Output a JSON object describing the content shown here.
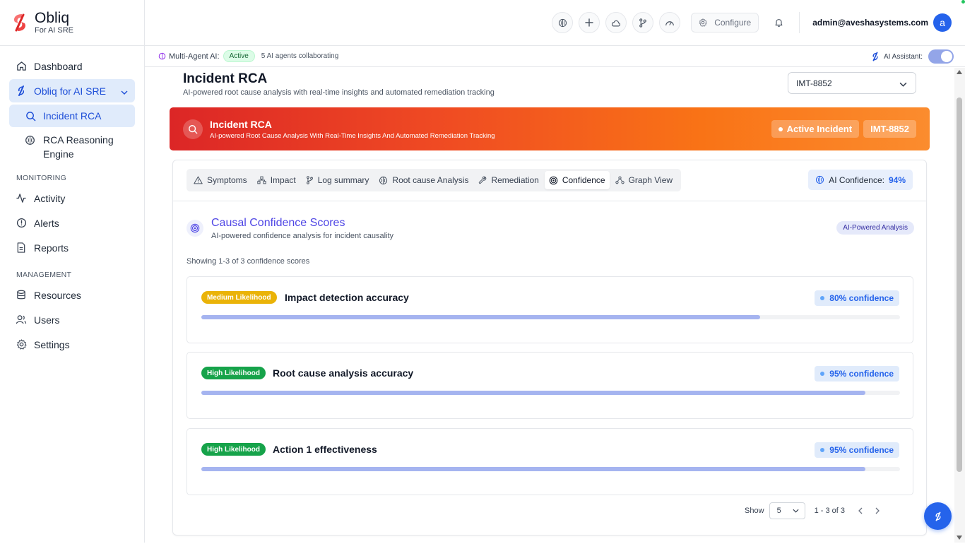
{
  "brand": {
    "name": "Obliq",
    "subtitle": "For AI SRE"
  },
  "sidebar": {
    "items": [
      {
        "label": "Dashboard",
        "icon": "home-icon"
      },
      {
        "label": "Obliq for AI SRE",
        "icon": "obliq-logo-icon"
      },
      {
        "label": "Incident RCA",
        "icon": "search-icon"
      },
      {
        "label": "RCA Reasoning Engine",
        "icon": "brain-icon"
      }
    ],
    "monitoring_title": "MONITORING",
    "monitoring": [
      {
        "label": "Activity",
        "icon": "activity-icon"
      },
      {
        "label": "Alerts",
        "icon": "alert-icon"
      },
      {
        "label": "Reports",
        "icon": "report-icon"
      }
    ],
    "management_title": "MANAGEMENT",
    "management": [
      {
        "label": "Resources",
        "icon": "database-icon"
      },
      {
        "label": "Users",
        "icon": "users-icon"
      },
      {
        "label": "Settings",
        "icon": "gear-icon"
      }
    ]
  },
  "topbar": {
    "configure_label": "Configure",
    "user_email": "admin@aveshasystems.com",
    "avatar_letter": "a"
  },
  "agentbar": {
    "label": "Multi-Agent AI:",
    "status": "Active",
    "note": "5 AI agents collaborating",
    "assistant_label": "AI Assistant:"
  },
  "page": {
    "title": "Incident RCA",
    "subtitle": "AI-powered root cause analysis with real-time insights and automated remediation tracking",
    "incident_select": "IMT-8852"
  },
  "banner": {
    "title": "Incident RCA",
    "subtitle": "AI-powered Root Cause Analysis With Real-Time Insights And Automated Remediation Tracking",
    "status_tag": "Active Incident",
    "id_tag": "IMT-8852"
  },
  "tabs": [
    {
      "label": "Symptoms",
      "icon": "warning-icon"
    },
    {
      "label": "Impact",
      "icon": "network-icon"
    },
    {
      "label": "Log summary",
      "icon": "git-branch-icon"
    },
    {
      "label": "Root cause Analysis",
      "icon": "brain-icon"
    },
    {
      "label": "Remediation",
      "icon": "wrench-icon"
    },
    {
      "label": "Confidence",
      "icon": "target-icon"
    },
    {
      "label": "Graph View",
      "icon": "graph-icon"
    }
  ],
  "active_tab": "Confidence",
  "ai_confidence": {
    "label": "AI Confidence:",
    "value": "94%"
  },
  "section": {
    "title": "Causal Confidence Scores",
    "subtitle": "AI-powered confidence analysis for incident causality",
    "badge": "AI-Powered Analysis",
    "showing": "Showing 1-3 of 3 confidence scores"
  },
  "scores": [
    {
      "likelihood": "Medium Likelihood",
      "level": "medium",
      "name": "Impact detection accuracy",
      "confidence_label": "80% confidence",
      "confidence": 0.8
    },
    {
      "likelihood": "High Likelihood",
      "level": "high",
      "name": "Root cause analysis accuracy",
      "confidence_label": "95% confidence",
      "confidence": 0.95
    },
    {
      "likelihood": "High Likelihood",
      "level": "high",
      "name": "Action 1 effectiveness",
      "confidence_label": "95% confidence",
      "confidence": 0.95
    }
  ],
  "pager": {
    "show_label": "Show",
    "page_size": "5",
    "range": "1 - 3 of 3"
  },
  "colors": {
    "accent": "#2563eb",
    "banner_start": "#dc2626",
    "banner_end": "#fb8c2e",
    "medium": "#eab308",
    "high": "#16a34a"
  }
}
